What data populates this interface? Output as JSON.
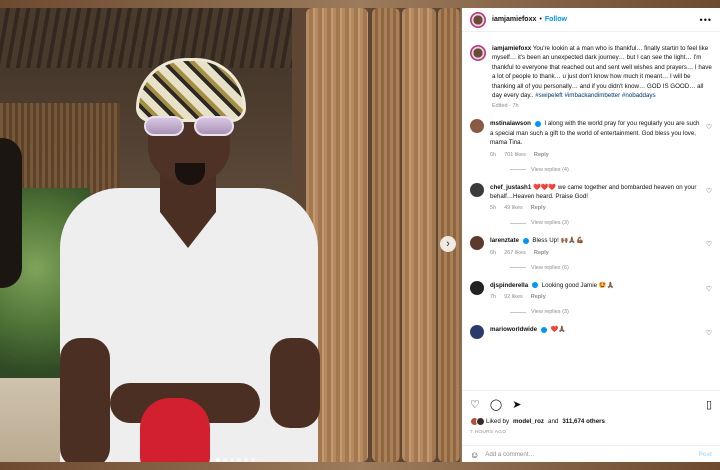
{
  "post": {
    "username": "iamjamiefoxx",
    "separator": "•",
    "follow_label": "Follow",
    "more_icon": "more-horizontal-icon",
    "caption": "You're lookin at a man who is thankful… finally startin to feel like myself… it's been an unexpected dark journey… but I can see the light… I'm thankful to everyone that reached out and sent well wishes and prayers… I have a lot of people to thank… u just don't know how much it meant… I will be thanking all of you personally… and if you didn't know… GOD IS GOOD… all day every day..",
    "hashtags": "#swipeleft #imbackandimbetter #nobaddays",
    "edited": "Edited · 7h"
  },
  "comments": [
    {
      "username": "mstinalawson",
      "verified": true,
      "text": "I along with the world pray for you regularly you are such a special man such a gift to the world of entertainment. God bless you love, mama Tina.",
      "time": "6h",
      "likes": "701 likes",
      "reply": "Reply",
      "view_replies": "View replies (4)",
      "avatar_color": "#8a5a44"
    },
    {
      "username": "chef_justash1",
      "verified": false,
      "text": "❤️❤️❤️ we came together and bombarded heaven on your behalf…Heaven heard. Praise God!",
      "time": "5h",
      "likes": "49 likes",
      "reply": "Reply",
      "view_replies": "View replies (3)",
      "avatar_color": "#3b3b3b"
    },
    {
      "username": "larenztate",
      "verified": true,
      "text": "Bless Up! 🙌🏾🙏🏾💪🏾",
      "time": "6h",
      "likes": "267 likes",
      "reply": "Reply",
      "view_replies": "View replies (6)",
      "avatar_color": "#5c3b2e"
    },
    {
      "username": "djspinderella",
      "verified": true,
      "text": "Looking good Jamie 🤩🙏🏾",
      "time": "7h",
      "likes": "92 likes",
      "reply": "Reply",
      "view_replies": "View replies (3)",
      "avatar_color": "#222222"
    },
    {
      "username": "marioworldwide",
      "verified": true,
      "text": "❤️🙏🏾",
      "time": "",
      "likes": "",
      "reply": "",
      "view_replies": "",
      "avatar_color": "#2a3b6b"
    }
  ],
  "footer": {
    "liked_prefix": "Liked by",
    "liked_user": "model_roz",
    "liked_and": "and",
    "liked_count": "311,674 others",
    "time_ago": "7 HOURS AGO",
    "add_comment_placeholder": "Add a comment…",
    "post_label": "Post",
    "icons": [
      "heart-icon",
      "comment-icon",
      "share-icon",
      "bookmark-icon"
    ]
  },
  "colors": {
    "accent": "#0095f6",
    "hashtag": "#00376b",
    "muted": "#8e8e8e"
  }
}
